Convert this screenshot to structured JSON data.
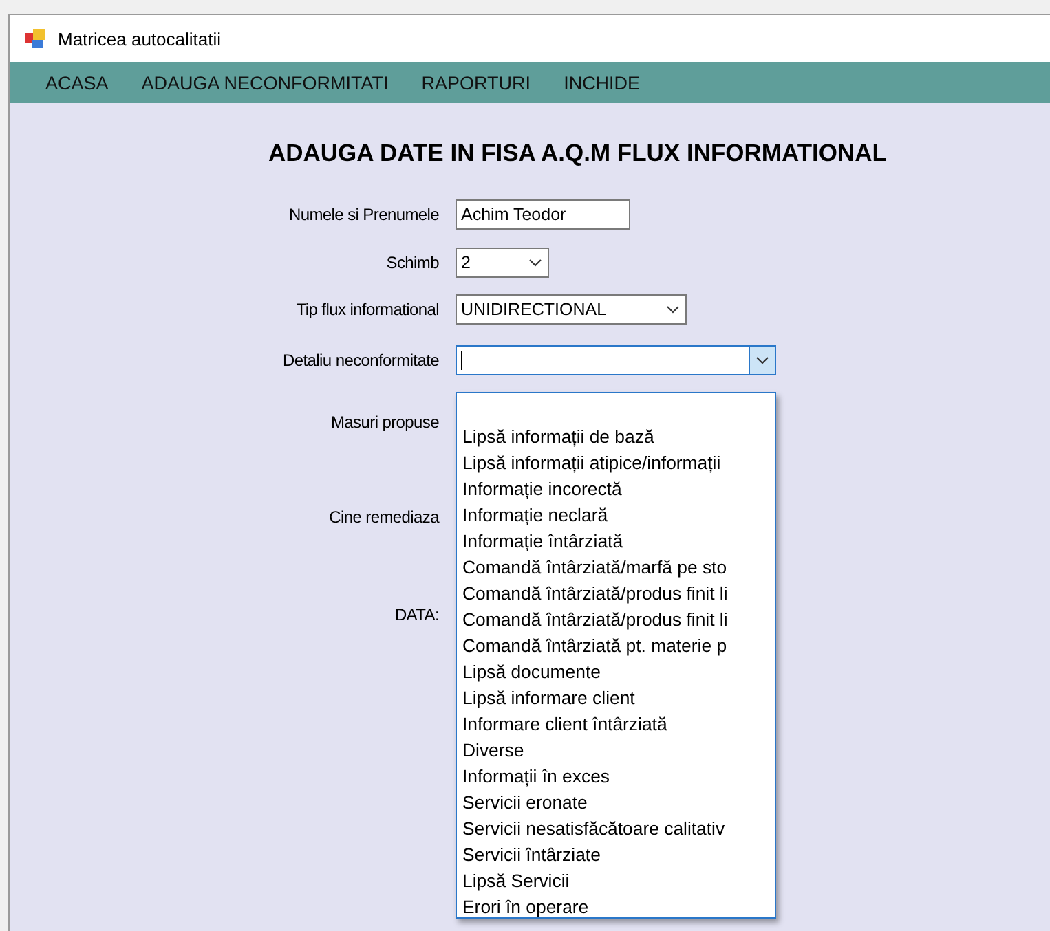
{
  "window": {
    "title": "Matricea autocalitatii"
  },
  "menu": [
    {
      "label": "ACASA"
    },
    {
      "label": "ADAUGA NECONFORMITATI"
    },
    {
      "label": "RAPORTURI"
    },
    {
      "label": "INCHIDE"
    }
  ],
  "heading": "ADAUGA DATE IN FISA A.Q.M FLUX INFORMATIONAL",
  "form": [
    {
      "kind": "text",
      "label": "Numele si Prenumele",
      "value": "Achim Teodor"
    },
    {
      "kind": "combo",
      "label": "Schimb",
      "value": "2"
    },
    {
      "kind": "combo",
      "label": "Tip flux informational",
      "value": "UNIDIRECTIONAL"
    },
    {
      "kind": "open-combo",
      "label": "Detaliu neconformitate",
      "focused": true
    },
    {
      "kind": "label",
      "label": "Masuri propuse"
    },
    {
      "kind": "label",
      "label": "Cine remediaza"
    },
    {
      "kind": "label",
      "label": "DATA:"
    }
  ],
  "dropdown": [
    "Lipsă informații de bază",
    "Lipsă informații atipice/informații",
    "Informație incorectă",
    "Informație neclară",
    "Informație întârziată",
    "Comandă întârziată/marfă pe sto",
    "Comandă întârziată/produs finit li",
    "Comandă întârziată/produs finit li",
    "Comandă întârziată pt. materie p",
    "Lipsă documente",
    "Lipsă informare client",
    "Informare client întârziată",
    "Diverse",
    "Informații în exces",
    "Servicii eronate",
    "Servicii nesatisfăcătoare calitativ",
    "Servicii întârziate",
    "Lipsă Servicii",
    "Erori în operare"
  ]
}
